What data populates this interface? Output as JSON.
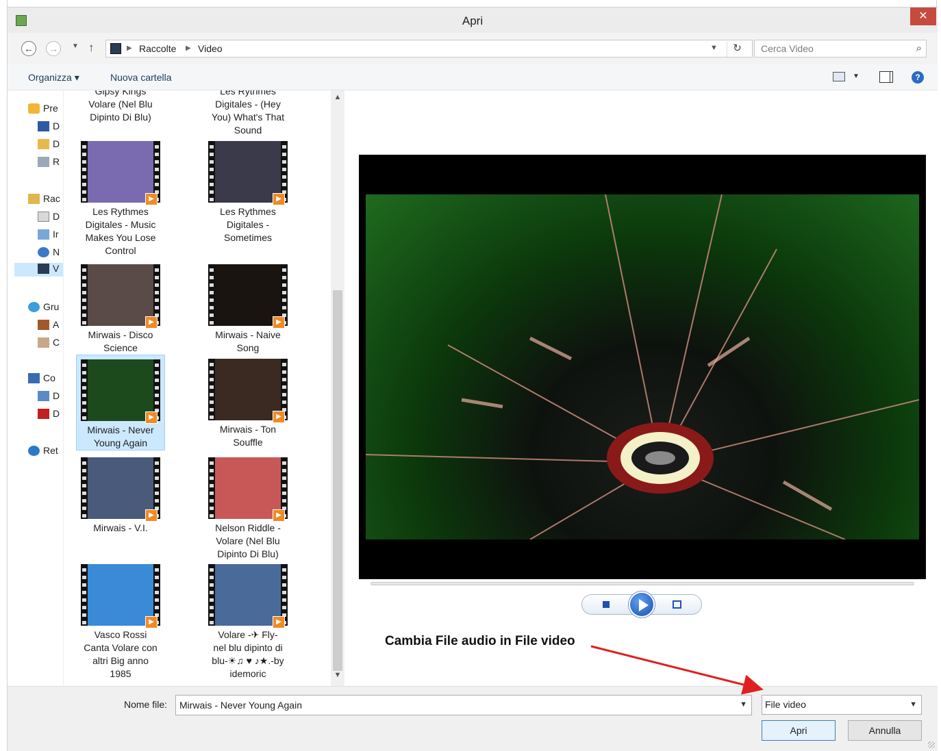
{
  "window": {
    "title": "Apri",
    "close_glyph": "✕"
  },
  "address": {
    "crumbs": [
      "Raccolte",
      "Video"
    ],
    "search_placeholder": "Cerca Video"
  },
  "toolbar": {
    "organize": "Organizza ▾",
    "new_folder": "Nuova cartella"
  },
  "nav": {
    "items": [
      {
        "label": "Pre",
        "icon": "star-icon"
      },
      {
        "label": "D",
        "icon": "desktop-icon"
      },
      {
        "label": "D",
        "icon": "downloads-icon"
      },
      {
        "label": "R",
        "icon": "recent-icon"
      },
      {
        "label": "Rac",
        "icon": "libraries-icon"
      },
      {
        "label": "D",
        "icon": "documents-icon"
      },
      {
        "label": "Ir",
        "icon": "pictures-icon"
      },
      {
        "label": "N",
        "icon": "music-icon"
      },
      {
        "label": "V",
        "icon": "videos-icon"
      },
      {
        "label": "Gru",
        "icon": "homegroup-icon"
      },
      {
        "label": "A",
        "icon": "user-icon"
      },
      {
        "label": "C",
        "icon": "user-icon"
      },
      {
        "label": "Co",
        "icon": "computer-icon"
      },
      {
        "label": "D",
        "icon": "drive-icon"
      },
      {
        "label": "D",
        "icon": "drive-icon"
      },
      {
        "label": "Ret",
        "icon": "network-icon"
      }
    ]
  },
  "files": {
    "partial_top": [
      "Gipsy Kings\nVolare (Nel Blu\nDipinto Di Blu)",
      "Les Rythmes\nDigitales - (Hey\nYou) What's That\nSound"
    ],
    "tiles": [
      {
        "label": "Les Rythmes\nDigitales - Music\nMakes You Lose\nControl",
        "thumb": "#7a6ab0"
      },
      {
        "label": "Les Rythmes\nDigitales -\nSometimes",
        "thumb": "#3a3a4a"
      },
      {
        "label": "Mirwais - Disco\nScience",
        "thumb": "#5a4a48"
      },
      {
        "label": "Mirwais - Naive\nSong",
        "thumb": "#1a1410"
      },
      {
        "label": "Mirwais - Never\nYoung Again",
        "thumb": "#1c4a1c",
        "selected": true
      },
      {
        "label": "Mirwais - Ton\nSouffle",
        "thumb": "#3a2a22"
      },
      {
        "label": "Mirwais - V.I.",
        "thumb": "#4a5a7a"
      },
      {
        "label": "Nelson Riddle -\nVolare (Nel Blu\nDipinto Di Blu)",
        "thumb": "#c85858"
      },
      {
        "label": "Vasco Rossi\nCanta Volare con\naltri Big anno\n1985",
        "thumb": "#3a8ad8"
      },
      {
        "label": "Volare -✈ Fly-\nnel blu dipinto di\nblu-☀♫ ♥ ♪★.-by\nidemoric",
        "thumb": "#4a6a9a"
      }
    ]
  },
  "preview": {
    "annotation": "Cambia File audio in File video"
  },
  "bottom": {
    "filename_label": "Nome file:",
    "filename_value": "Mirwais - Never Young Again",
    "filetype_value": "File video",
    "open_label": "Apri",
    "cancel_label": "Annulla"
  },
  "colors": {
    "accent": "#3c7fb1",
    "selection": "#cce8ff",
    "close": "#c74a3e",
    "annotation_arrow": "#e02020"
  }
}
